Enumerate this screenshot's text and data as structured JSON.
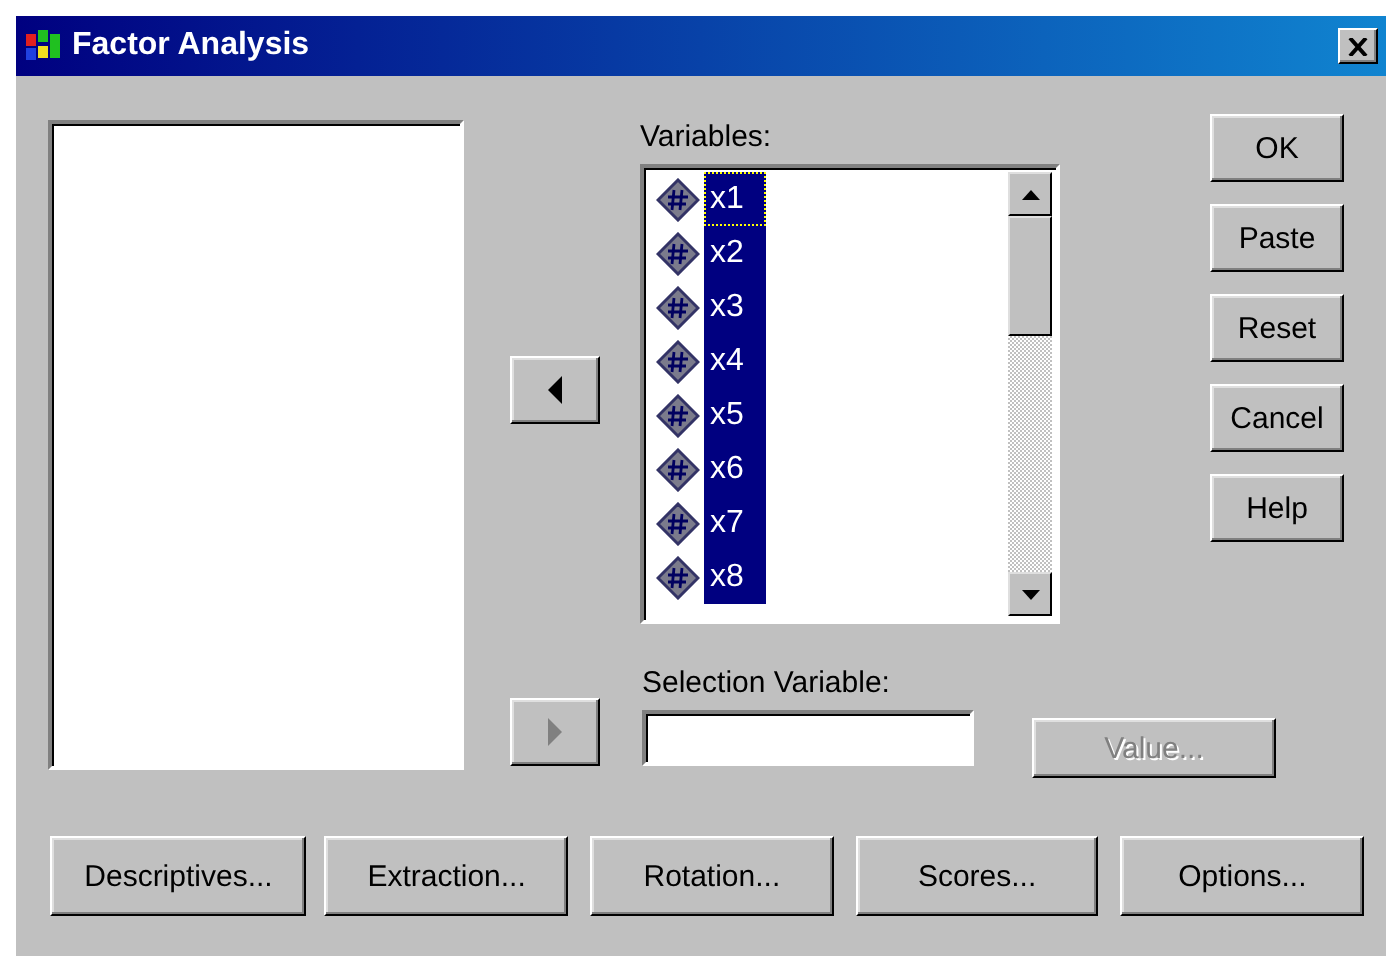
{
  "window": {
    "title": "Factor Analysis"
  },
  "move_buttons": [
    {
      "kind": "left",
      "disabled": false
    },
    {
      "kind": "right",
      "disabled": true
    }
  ],
  "variables": {
    "label": "Variables:",
    "items": [
      {
        "label": "x1",
        "selected": true,
        "focused": true
      },
      {
        "label": "x2",
        "selected": true,
        "focused": false
      },
      {
        "label": "x3",
        "selected": true,
        "focused": false
      },
      {
        "label": "x4",
        "selected": true,
        "focused": false
      },
      {
        "label": "x5",
        "selected": true,
        "focused": false
      },
      {
        "label": "x6",
        "selected": true,
        "focused": false
      },
      {
        "label": "x7",
        "selected": true,
        "focused": false
      },
      {
        "label": "x8",
        "selected": true,
        "focused": false
      }
    ]
  },
  "side_buttons": [
    {
      "label": "OK",
      "disabled": false
    },
    {
      "label": "Paste",
      "disabled": false
    },
    {
      "label": "Reset",
      "disabled": false
    },
    {
      "label": "Cancel",
      "disabled": false
    },
    {
      "label": "Help",
      "disabled": false
    }
  ],
  "selection_variable": {
    "label": "Selection Variable:"
  },
  "value_button": {
    "label": "Value...",
    "disabled": true
  },
  "bottom_buttons": [
    {
      "label": "Descriptives...",
      "disabled": false
    },
    {
      "label": "Extraction...",
      "disabled": false
    },
    {
      "label": "Rotation...",
      "disabled": false
    },
    {
      "label": "Scores...",
      "disabled": false
    },
    {
      "label": "Options...",
      "disabled": false
    }
  ]
}
